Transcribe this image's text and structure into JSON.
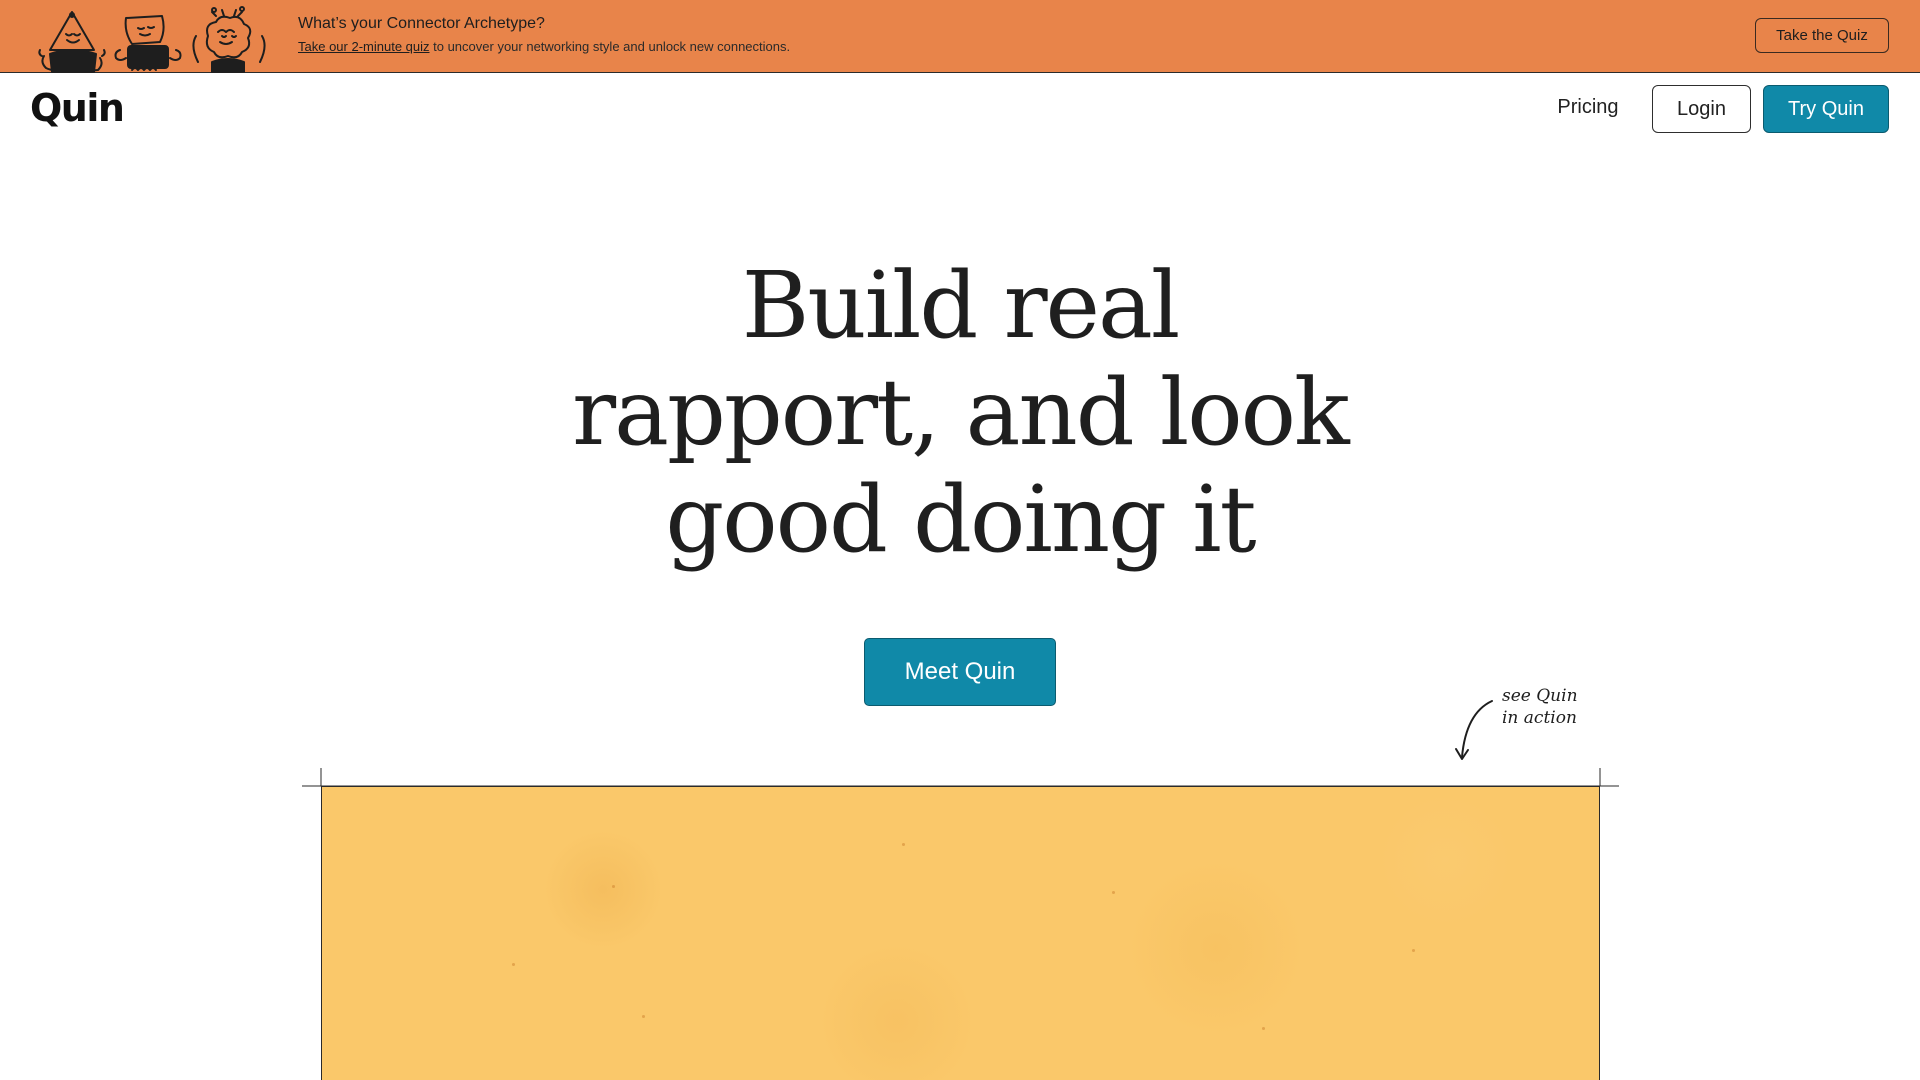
{
  "banner": {
    "title": "What’s your Connector Archetype?",
    "link_text": "Take our 2-minute quiz",
    "subtitle_rest": " to uncover your networking style and unlock new connections.",
    "cta_label": "Take the Quiz",
    "illustrations": [
      "triangle-character-icon",
      "square-character-icon",
      "brain-character-icon"
    ]
  },
  "nav": {
    "logo": "Quin",
    "pricing_label": "Pricing",
    "login_label": "Login",
    "try_label": "Try Quin"
  },
  "hero": {
    "title_lines": [
      "Build real",
      "rapport, and look",
      "good doing it"
    ],
    "cta_label": "Meet Quin"
  },
  "annotation": {
    "lines": [
      "see Quin",
      "in action"
    ],
    "icon": "curved-arrow-down-icon"
  },
  "colors": {
    "banner_bg": "#e8844a",
    "primary_button": "#1089a8",
    "video_panel": "#fac86a",
    "page_bg": "#ffffff"
  }
}
